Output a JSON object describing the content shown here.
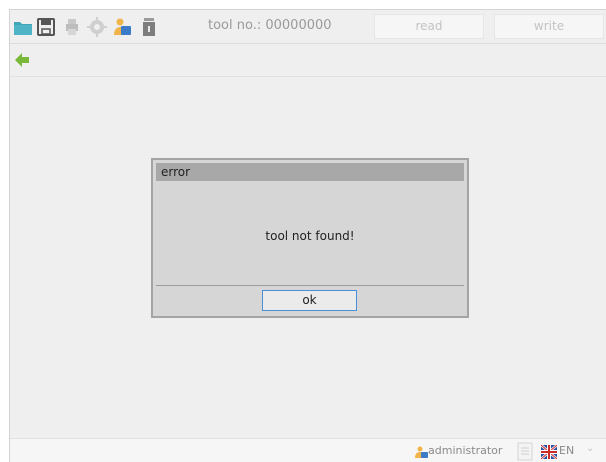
{
  "toolbar": {
    "icons": [
      "folder-icon",
      "save-icon",
      "print-icon",
      "settings-icon",
      "user-icon",
      "device-icon"
    ],
    "tool_no": "tool no.: 00000000",
    "read_label": "read",
    "write_label": "write"
  },
  "nav": {
    "back_icon": "back-arrow-icon"
  },
  "dialog": {
    "title": "error",
    "message": "tool not found!",
    "ok_label": "ok"
  },
  "statusbar": {
    "user": "administrator",
    "language": "EN"
  },
  "colors": {
    "accent_green": "#7ab83a",
    "folder_teal": "#3fa6b8",
    "ok_border": "#4a90d8"
  }
}
